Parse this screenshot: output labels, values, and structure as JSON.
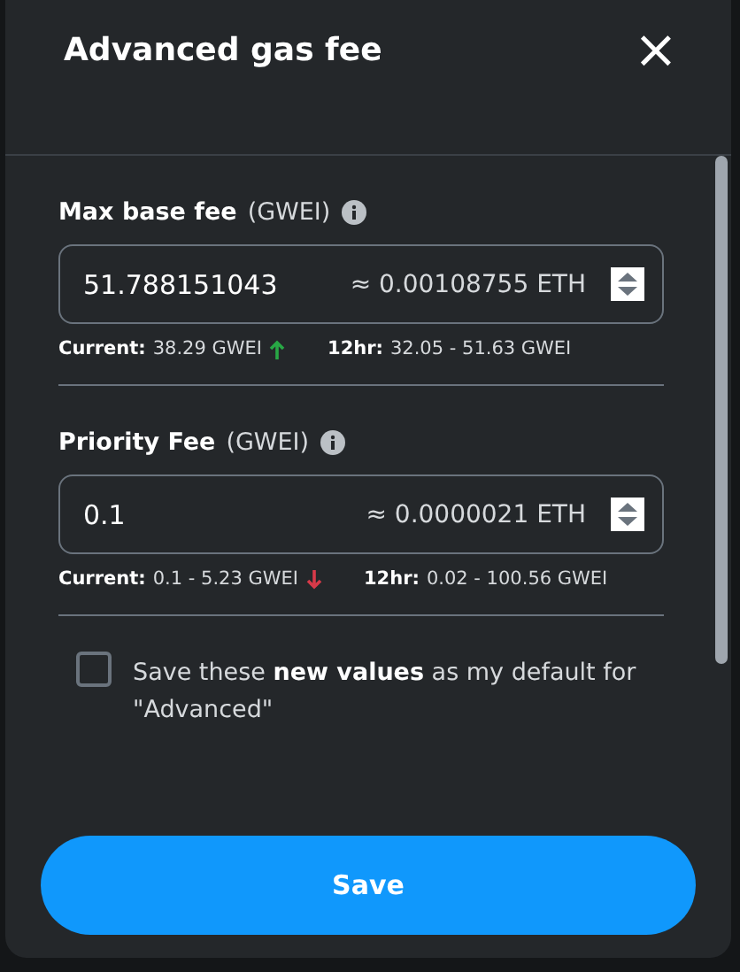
{
  "dialog": {
    "title": "Advanced gas fee",
    "close": "×"
  },
  "fields": [
    {
      "label": "Max base fee",
      "unit": "(GWEI)",
      "value": "51.788151043",
      "conversion": "≈ 0.00108755 ETH",
      "current_label": "Current:",
      "current": "38.29 GWEI",
      "rising": true,
      "range_label": "12hr:",
      "range": "32.05 - 51.63 GWEI"
    },
    {
      "label": "Priority Fee",
      "unit": "(GWEI)",
      "value": "0.1",
      "conversion": "≈ 0.0000021 ETH",
      "current_label": "Current:",
      "current": "0.1 - 5.23 GWEI",
      "rising": false,
      "range_label": "12hr:",
      "range": "0.02 - 100.56 GWEI"
    }
  ],
  "default_option": {
    "checked": false,
    "text": "Save these **new values** as my default for \"Advanced\""
  },
  "button": "Save"
}
